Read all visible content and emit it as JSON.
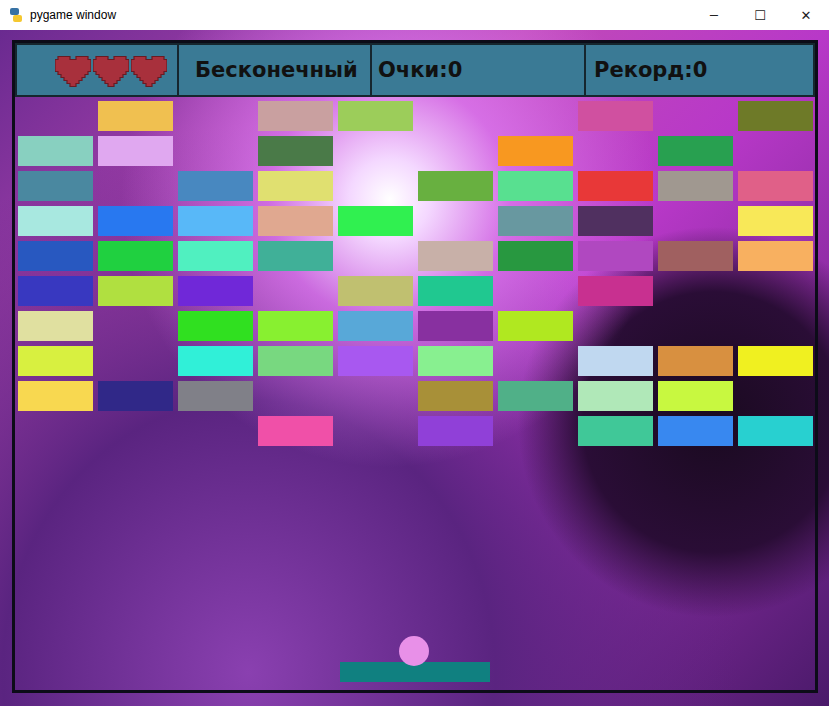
{
  "window": {
    "title": "pygame window",
    "controls": [
      "─",
      "☐",
      "✕"
    ]
  },
  "hud": {
    "lives": [
      {
        "full": true
      },
      {
        "full": true
      },
      {
        "full": true
      }
    ],
    "mode": "Бесконечный",
    "score": "Очки:0",
    "record": "Рекорд:0"
  },
  "bricks": [
    [
      null,
      "#f0c050",
      null,
      "#c9a0a0",
      "#9ccd5a",
      null,
      null,
      "#d050a0",
      null,
      "#6e7a28"
    ],
    [
      "#88d0c0",
      "#e0a8f0",
      null,
      "#4a7a48",
      null,
      null,
      "#f89820",
      null,
      "#28a050",
      null
    ],
    [
      "#4a88a0",
      null,
      "#4888c0",
      "#e0e070",
      null,
      "#68b040",
      "#58e090",
      "#e83838",
      "#a09890",
      "#e06088"
    ],
    [
      "#a8e8e0",
      "#2878f0",
      "#58b8f8",
      "#e0a890",
      "#30f050",
      null,
      "#6898a0",
      "#503060",
      null,
      "#f8e858"
    ],
    [
      "#2858c0",
      "#20d040",
      "#50f0c0",
      "#40b098",
      null,
      "#c8b0a8",
      "#289840",
      "#b048c0",
      "#a06060",
      "#f8b060"
    ],
    [
      "#3838c0",
      "#b0e040",
      "#7028d8",
      null,
      "#c0c070",
      "#20c890",
      null,
      "#c83090",
      null,
      null
    ],
    [
      "#e0e0a0",
      null,
      "#30e020",
      "#88f030",
      "#58a8d8",
      "#8830a0",
      "#b0e820",
      null,
      null,
      null
    ],
    [
      "#d8f040",
      null,
      "#30f0d8",
      "#78d880",
      "#a858f0",
      "#88f090",
      null,
      "#c0d8f0",
      "#d89040",
      "#f0f020"
    ],
    [
      "#f8d850",
      "#302888",
      "#808088",
      null,
      null,
      "#a89038",
      "#50b088",
      "#b0e8b8",
      "#c8f840",
      null
    ],
    [
      null,
      null,
      null,
      "#f050a8",
      null,
      "#9040d8",
      null,
      "#40c898",
      "#3888f0",
      "#28d0d0"
    ]
  ],
  "paddle": {
    "color": "#108080"
  },
  "ball": {
    "color": "#e890e8"
  }
}
